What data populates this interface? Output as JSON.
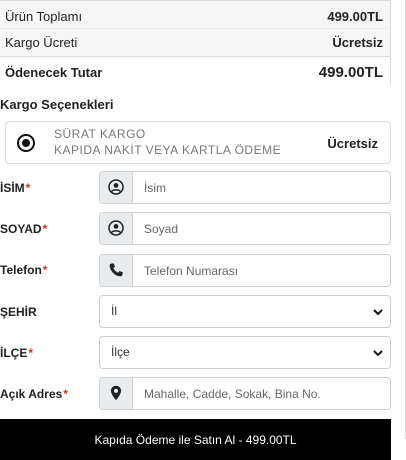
{
  "summary": {
    "subtotal_label": "Ürün Toplamı",
    "subtotal_value": "499.00TL",
    "shipping_fee_label": "Kargo Ücreti",
    "shipping_fee_value": "Ücretsiz",
    "total_label": "Ödenecek Tutar",
    "total_value": "499.00TL"
  },
  "shipping_options": {
    "title": "Kargo Seçenekleri",
    "selected": {
      "name": "SÜRAT KARGO",
      "description": "KAPIDA NAKİT VEYA KARTLA ÖDEME",
      "price": "Ücretsiz"
    }
  },
  "form": {
    "required_marker": "*",
    "name": {
      "label": "İSİM",
      "placeholder": "İsim",
      "icon": "user-icon"
    },
    "surname": {
      "label": "SOYAD",
      "placeholder": "Soyad",
      "icon": "user-icon"
    },
    "phone": {
      "label": "Telefon",
      "placeholder": "Telefon Numarası",
      "icon": "phone-icon"
    },
    "city": {
      "label": "ŞEHİR",
      "value": "İl"
    },
    "district": {
      "label": "İLÇE",
      "value": "İlçe"
    },
    "address": {
      "label": "Açık Adres",
      "placeholder": "Mahalle, Cadde, Sokak, Bina No.",
      "icon": "map-marker-icon"
    }
  },
  "submit": {
    "label": "Kapıda Ödeme ile Satın Al - 499.00TL"
  },
  "colors": {
    "required": "#c0392b",
    "button_bg": "#000000",
    "addon_bg": "#e9ecef"
  }
}
